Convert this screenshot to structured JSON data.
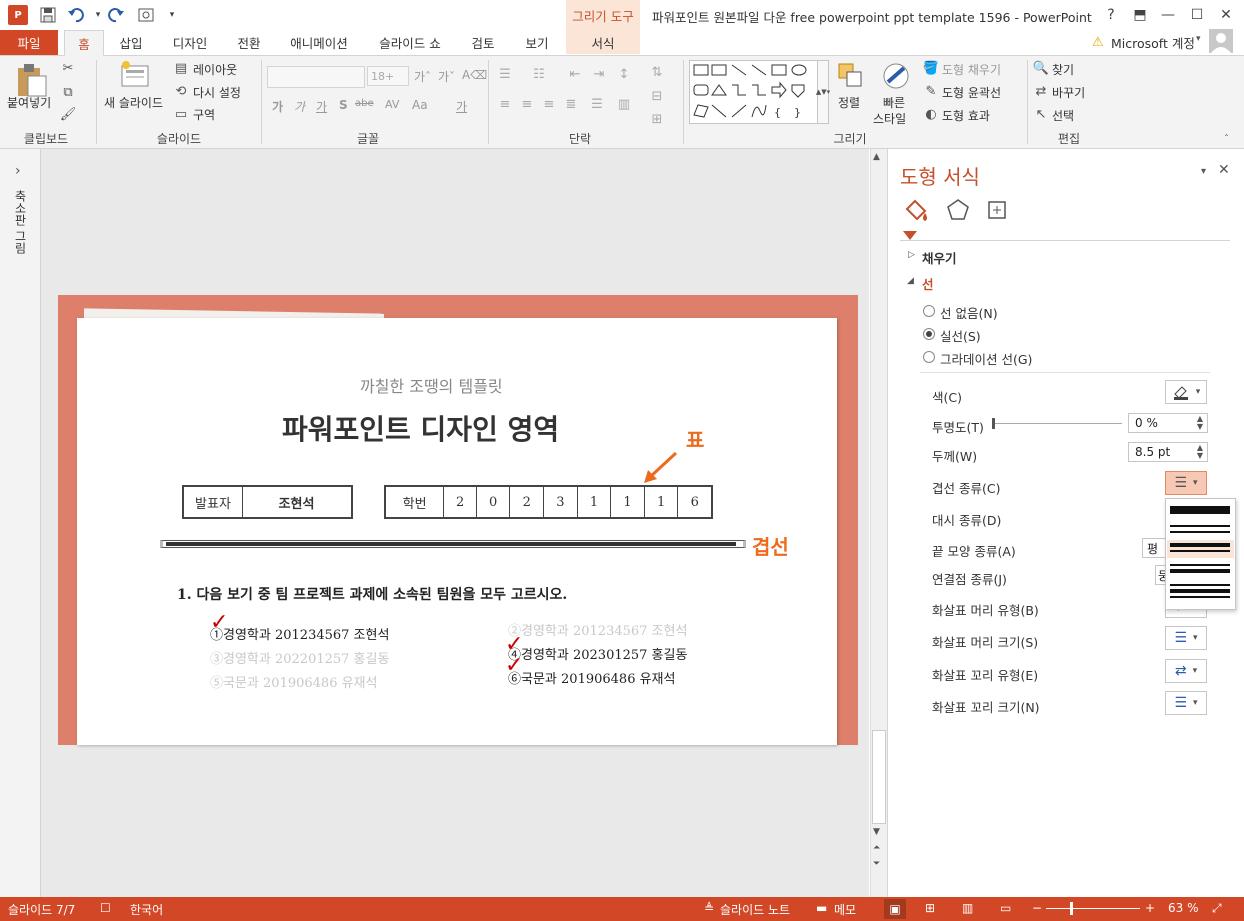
{
  "window": {
    "app_badge": "P",
    "title": "파워포인트 원본파일 다운 free powerpoint ppt template 1596 - PowerPoint",
    "context_tab_header": "그리기 도구",
    "account": "Microsoft 계정",
    "warning_glyph": "⚠",
    "help_glyph": "?",
    "restore_ribbon_glyph": "⬒",
    "minimize_glyph": "—",
    "maximize_glyph": "☐",
    "close_glyph": "✕",
    "qa_toolbar": [
      "save-icon",
      "undo-icon",
      "redo-icon",
      "touch-mode-icon",
      "customize-icon"
    ]
  },
  "tabs": [
    "파일",
    "홈",
    "삽입",
    "디자인",
    "전환",
    "애니메이션",
    "슬라이드 쇼",
    "검토",
    "보기",
    "서식"
  ],
  "ribbon": {
    "clipboard": {
      "paste": "붙여넣기",
      "label": "클립보드"
    },
    "slides": {
      "new_slide": "새 슬라이드",
      "layout": "레이아웃",
      "reset": "다시 설정",
      "section": "구역",
      "label": "슬라이드"
    },
    "font": {
      "size": "18+",
      "bold": "가",
      "italic": "가",
      "underline": "가",
      "shadow": "S",
      "strike": "abe",
      "spacing": "AV",
      "case": "Aa",
      "color": "가",
      "label": "글꼴"
    },
    "paragraph": {
      "label": "단락"
    },
    "drawing": {
      "arrange": "정렬",
      "quick_styles_1": "빠른",
      "quick_styles_2": "스타일",
      "fill": "도형 채우기",
      "outline": "도형 윤곽선",
      "effects": "도형 효과",
      "label": "그리기"
    },
    "editing": {
      "find": "찾기",
      "replace": "바꾸기",
      "select": "선택",
      "label": "편집"
    }
  },
  "left_pane": {
    "label": "축소판 그림",
    "expand_glyph": "›"
  },
  "slide": {
    "subtitle": "까칠한 조땡의 템플릿",
    "title": "파워포인트 디자인 영역",
    "presenter_label": "발표자",
    "presenter_name": "조현석",
    "student_id_label": "학번",
    "student_id_digits": [
      "2",
      "0",
      "2",
      "3",
      "1",
      "1",
      "1",
      "6"
    ],
    "annotation_table": "표",
    "annotation_compound": "겹선",
    "question": "1. 다음 보기 중 팀 프로젝트 과제에 소속된 팀원을 모두 고르시오.",
    "options": [
      {
        "mark": "①",
        "text": "경영학과 201234567 조현석",
        "checked": true,
        "faded": false
      },
      {
        "mark": "②",
        "text": "경영학과 201234567 조현석",
        "checked": false,
        "faded": true
      },
      {
        "mark": "③",
        "text": "경영학과 202201257 홍길동",
        "checked": false,
        "faded": true
      },
      {
        "mark": "④",
        "text": "경영학과 202301257 홍길동",
        "checked": true,
        "faded": false
      },
      {
        "mark": "⑤",
        "text": "국문과   201906486 유재석",
        "checked": false,
        "faded": true
      },
      {
        "mark": "⑥",
        "text": "국문과   201906486 유재석",
        "checked": true,
        "faded": false
      }
    ],
    "check_glyph": "✓"
  },
  "format_pane": {
    "title": "도형 서식",
    "fill_section": "채우기",
    "line_section": "선",
    "radio_none": "선 없음(N)",
    "radio_solid": "실선(S)",
    "radio_gradient": "그라데이션 선(G)",
    "selected_radio": "solid",
    "color_label": "색(C)",
    "transparency_label": "투명도(T)",
    "transparency_value": "0 %",
    "width_label": "두께(W)",
    "width_value": "8.5 pt",
    "compound_label": "겹선 종류(C)",
    "dash_label": "대시 종류(D)",
    "cap_label": "끝 모양 종류(A)",
    "cap_value": "평",
    "join_label": "연결점 종류(J)",
    "join_value": "둥",
    "arrow_begin_type": "화살표 머리 유형(B)",
    "arrow_begin_size": "화살표 머리 크기(S)",
    "arrow_end_type": "화살표 꼬리 유형(E)",
    "arrow_end_size": "화살표 꼬리 크기(N)",
    "accent": "#c5502d"
  },
  "status": {
    "slide": "슬라이드 7/7",
    "language": "한국어",
    "notes": "슬라이드 노트",
    "comments": "메모",
    "zoom": "63 %"
  },
  "colors": {
    "brand": "#d24726",
    "slide_bg": "#dd7f6a",
    "annotation": "#ee6a1c"
  }
}
